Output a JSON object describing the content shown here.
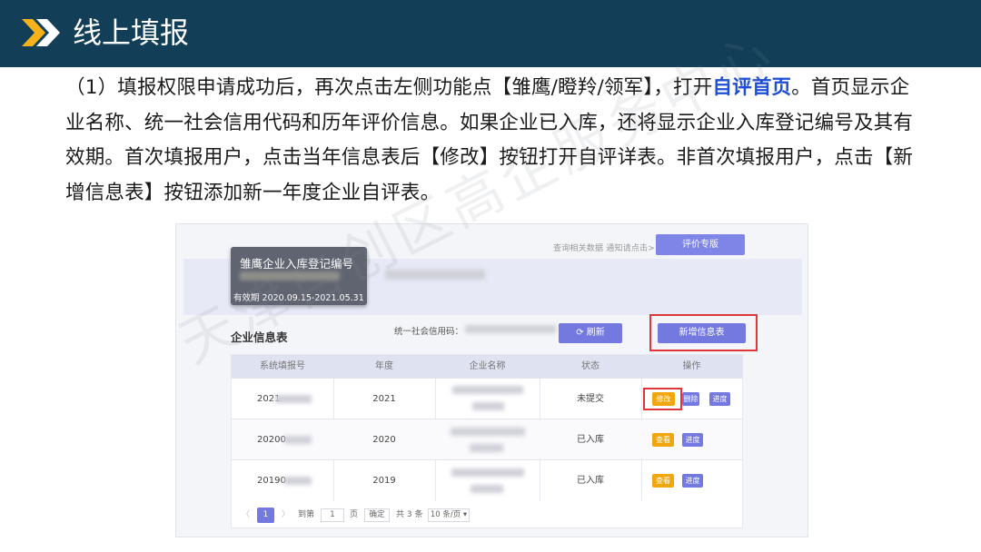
{
  "header": {
    "title": "线上填报",
    "icon": "double-chevron-icon",
    "bg": "#123e58",
    "accent": "#f5b21b"
  },
  "paragraph": {
    "p1": "（1）填报权限申请成功后，再次点击左侧功能点【雏鹰/瞪羚/领军】，打开",
    "highlight": "自评首页",
    "p2": "。首页显示企业名称、统一社会信用代码和历年评价信息。如果企业已入库，还将显示企业入库登记编号及其有效期。首次填报用户，点击当年信息表后【修改】按钮打开自评详表。非首次填报用户，点击【新增信息表】按钮添加新一年度企业自评表。",
    "highlight_color": "#1d4fd6"
  },
  "watermark": "天津自创区高企服务中心",
  "screenshot": {
    "top_links": "查询相关数据   通知请点击>>",
    "pro_button": "评价专版",
    "card": {
      "title": "雏鹰企业入库登记编号",
      "validity": "有效期 2020.09.15-2021.05.31"
    },
    "credit_label": "统一社会信用码：",
    "section_title": "企业信息表",
    "refresh_button": "刷新",
    "refresh_icon": "refresh-icon",
    "new_button": "新增信息表",
    "table": {
      "headers": [
        "系统填报号",
        "年度",
        "企业名称",
        "状态",
        "操作"
      ],
      "rows": [
        {
          "id": "2021",
          "year": "2021",
          "status": "未提交",
          "actions": [
            "修改",
            "删除",
            "进度"
          ]
        },
        {
          "id": "20200",
          "year": "2020",
          "status": "已入库",
          "actions": [
            "查看",
            "进度"
          ]
        },
        {
          "id": "20190",
          "year": "2019",
          "status": "已入库",
          "actions": [
            "查看",
            "进度"
          ]
        }
      ]
    },
    "pager": {
      "prev": "〈",
      "current": "1",
      "next": "〉",
      "goto": "到第",
      "page_input": "1",
      "page_unit": "页",
      "confirm": "确定",
      "total": "共 3 条",
      "per_page": "10 条/页 ▾"
    },
    "colors": {
      "primary": "#7479e0",
      "warning": "#f2a60e",
      "highlight_box": "#e0363a"
    }
  }
}
